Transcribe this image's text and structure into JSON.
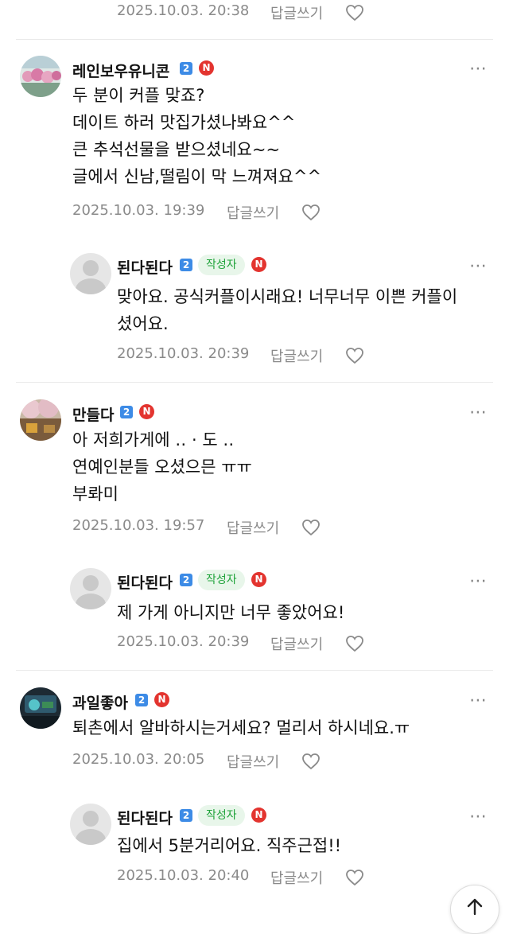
{
  "top": {
    "time": "2025.10.03. 20:38",
    "reply": "답글쓰기"
  },
  "comments": [
    {
      "author": "레인보우유니콘",
      "level": "2",
      "new": "N",
      "text": "두 분이 커플 맞죠?\n데이트 하러 맛집가셨나봐요^^\n큰 추석선물을 받으셨네요~~\n글에서 신남,떨림이 막 느껴져요^^",
      "time": "2025.10.03. 19:39",
      "reply": "답글쓰기",
      "avatar": "pink-flowers-photo"
    },
    {
      "author": "된다된다",
      "level": "2",
      "tag": "작성자",
      "new": "N",
      "text": "맞아요. 공식커플이시래요! 너무너무 이쁜 커플이\n셨어요.",
      "time": "2025.10.03. 20:39",
      "reply": "답글쓰기",
      "avatar": "default-avatar"
    },
    {
      "author": "만들다",
      "level": "2",
      "new": "N",
      "text": "아 저희가게에 ‥ · 도 ‥\n연예인분들 오셨으믄 ㅠㅠ\n부롸미",
      "time": "2025.10.03. 19:57",
      "reply": "답글쓰기",
      "avatar": "cherry-blossom-photo"
    },
    {
      "author": "된다된다",
      "level": "2",
      "tag": "작성자",
      "new": "N",
      "text": "제 가게 아니지만 너무 좋았어요!",
      "time": "2025.10.03. 20:39",
      "reply": "답글쓰기",
      "avatar": "default-avatar"
    },
    {
      "author": "과일좋아",
      "level": "2",
      "new": "N",
      "text": "퇴촌에서 알바하시는거세요? 멀리서 하시네요.ㅠ",
      "time": "2025.10.03. 20:05",
      "reply": "답글쓰기",
      "avatar": "dark-photo"
    },
    {
      "author": "된다된다",
      "level": "2",
      "tag": "작성자",
      "new": "N",
      "text": "집에서 5분거리어요. 직주근접!!",
      "time": "2025.10.03. 20:40",
      "reply": "답글쓰기",
      "avatar": "default-avatar"
    }
  ],
  "more_icon": "⋯",
  "scroll_top_icon": "arrow-up-icon"
}
